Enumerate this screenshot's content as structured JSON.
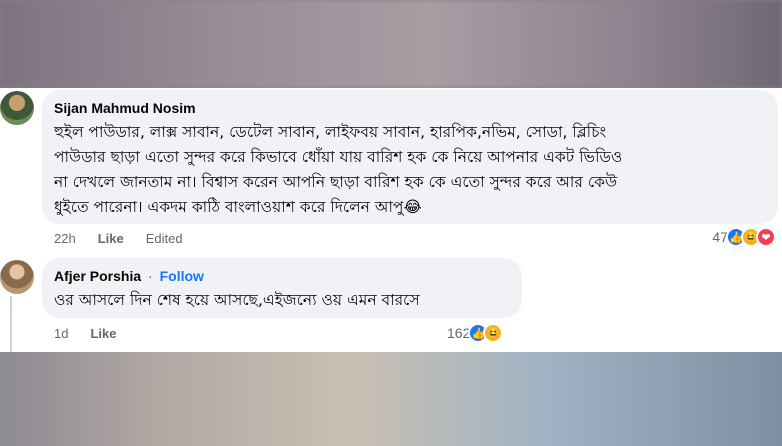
{
  "comments": [
    {
      "author": "Sijan Mahmud Nosim",
      "lines": [
        "হুইল পাউডার, লাক্স সাবান, ডেটেল সাবান, লাইফবয় সাবান, হারপিক,নভিম, সোডা, ব্লিচিং",
        "পাউডার ছাড়া এতো সুন্দর করে কিভাবে ধোঁয়া যায় বারিশ হক কে নিয়ে আপনার একট ভিডিও",
        "না দেখলে জানতাম না। বিশ্বাস করেন আপনি ছাড়া বারিশ হক কে এতো সুন্দর করে আর কেউ",
        "ধুইতে পারেনা। একদম কাঠি বাংলাওয়াশ করে দিলেন আপু😂"
      ],
      "time": "22h",
      "like_label": "Like",
      "edited_label": "Edited",
      "reaction_count": "47",
      "reactions": [
        "like-icon",
        "haha-icon",
        "love-icon"
      ]
    },
    {
      "author": "Afjer Porshia",
      "separator": "·",
      "follow_label": "Follow",
      "lines": [
        "ওর আসলে দিন শেষ হয়ে আসছে,এইজন্যে ওয় এমন বারসে"
      ],
      "time": "1d",
      "like_label": "Like",
      "reaction_count": "162",
      "reactions": [
        "like-icon",
        "haha-icon"
      ]
    }
  ],
  "colors": {
    "bubble": "#f0f2f5",
    "link": "#1877f2",
    "meta": "#65676b",
    "text": "#050505"
  }
}
